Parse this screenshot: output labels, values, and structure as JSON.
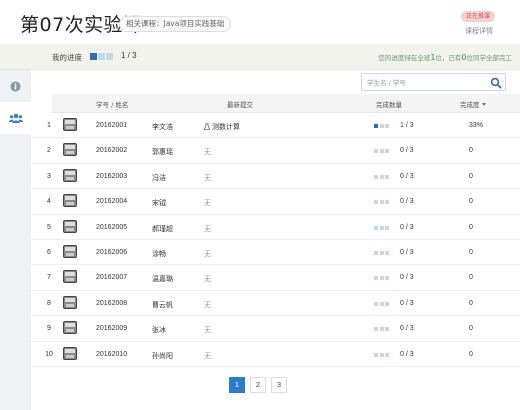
{
  "header": {
    "title": "第07次实验课",
    "course_tag": "相关课程：Java项目实践基础",
    "status_badge": "正在推课",
    "detail_link": "课程详情"
  },
  "progress": {
    "label": "我的进度",
    "completed": 1,
    "total": 3,
    "count_text": "1 / 3",
    "note_prefix": "您的进度排在全班",
    "rank": "1",
    "note_middle": "位，已有",
    "finished_count": "0",
    "note_suffix": "位同学全部完工"
  },
  "sidebar": {
    "items": [
      {
        "icon": "info-icon",
        "active": false
      },
      {
        "icon": "users-icon",
        "active": true
      }
    ]
  },
  "search": {
    "placeholder": "学生名 / 学号",
    "value": ""
  },
  "table": {
    "headers": {
      "student": "学号 / 姓名",
      "latest_submit": "最新提交",
      "completed_count": "完成数量",
      "completion_rate": "完成度"
    },
    "rows": [
      {
        "index": "1",
        "id": "20162001",
        "name": "李文浩",
        "submit": "测数计算",
        "has_submit": true,
        "done": 1,
        "count_text": "1 / 3",
        "rate": "33%"
      },
      {
        "index": "2",
        "id": "20162002",
        "name": "郭惠瑶",
        "submit": "无",
        "has_submit": false,
        "done": 0,
        "count_text": "0 / 3",
        "rate": "0"
      },
      {
        "index": "3",
        "id": "20162003",
        "name": "冯洁",
        "submit": "无",
        "has_submit": false,
        "done": 0,
        "count_text": "0 / 3",
        "rate": "0"
      },
      {
        "index": "4",
        "id": "20162004",
        "name": "宋钺",
        "submit": "无",
        "has_submit": false,
        "done": 0,
        "count_text": "0 / 3",
        "rate": "0"
      },
      {
        "index": "5",
        "id": "20162005",
        "name": "郝瑾超",
        "submit": "无",
        "has_submit": false,
        "done": 0,
        "count_text": "0 / 3",
        "rate": "0"
      },
      {
        "index": "6",
        "id": "20162006",
        "name": "涂畅",
        "submit": "无",
        "has_submit": false,
        "done": 0,
        "count_text": "0 / 3",
        "rate": "0"
      },
      {
        "index": "7",
        "id": "20162007",
        "name": "温嘉璐",
        "submit": "无",
        "has_submit": false,
        "done": 0,
        "count_text": "0 / 3",
        "rate": "0"
      },
      {
        "index": "8",
        "id": "20162008",
        "name": "曹云帆",
        "submit": "无",
        "has_submit": false,
        "done": 0,
        "count_text": "0 / 3",
        "rate": "0"
      },
      {
        "index": "9",
        "id": "20162009",
        "name": "张冰",
        "submit": "无",
        "has_submit": false,
        "done": 0,
        "count_text": "0 / 3",
        "rate": "0"
      },
      {
        "index": "10",
        "id": "20162010",
        "name": "孙尚阳",
        "submit": "无",
        "has_submit": false,
        "done": 0,
        "count_text": "0 / 3",
        "rate": "0"
      }
    ]
  },
  "pagination": {
    "pages": [
      "1",
      "2",
      "3"
    ],
    "current": "1"
  },
  "colors": {
    "accent": "#2d7dc8",
    "block_done": "#2d6fb0",
    "block_todo": "#c6d9ea",
    "rank_green": "#3a8a3a"
  }
}
